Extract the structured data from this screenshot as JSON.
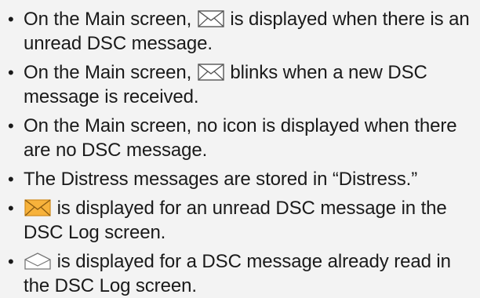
{
  "notes": [
    {
      "before": "On the Main screen, ",
      "icon": "unread-mail-icon",
      "after": " is displayed when there is an unread DSC message."
    },
    {
      "before": "On the Main screen, ",
      "icon": "unread-mail-icon",
      "after": " blinks when a new DSC message is received."
    },
    {
      "before": "On the Main screen, no icon is displayed when there are no DSC message.",
      "icon": null,
      "after": ""
    },
    {
      "before": "The Distress messages are stored in “Distress.”",
      "icon": null,
      "after": ""
    },
    {
      "before": "",
      "icon": "unread-log-mail-icon",
      "after": " is displayed for an unread DSC message in the DSC Log screen."
    },
    {
      "before": "",
      "icon": "read-mail-icon",
      "after": " is displayed for a DSC message already read in the DSC Log screen."
    }
  ],
  "bullet": "•",
  "colors": {
    "background": "#f3f3f3",
    "text": "#1a1a1a",
    "icon_outline": "#555555",
    "unread_log_fill": "#f7b23b",
    "read_fill": "#ffffff"
  }
}
